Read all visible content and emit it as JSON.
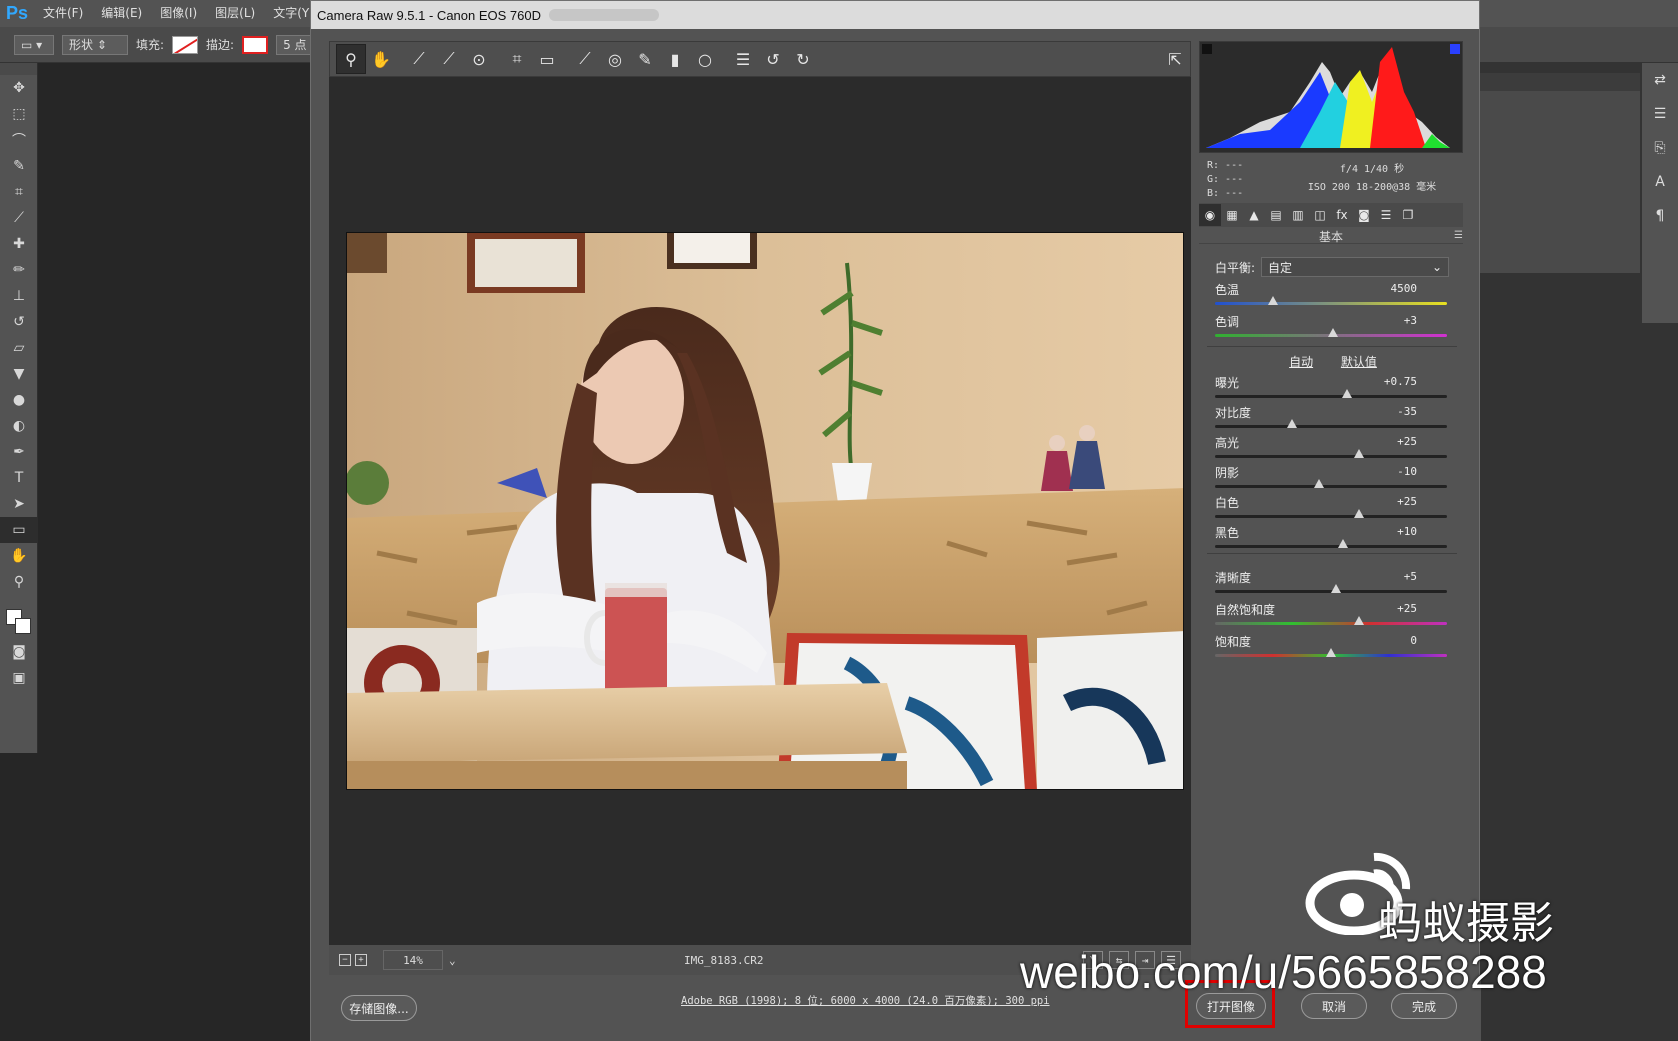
{
  "ps": {
    "logo": "Ps",
    "menu": [
      "文件(F)",
      "编辑(E)",
      "图像(I)",
      "图层(L)",
      "文字(Y)"
    ],
    "options": {
      "shape_mode": "形状",
      "fill_label": "填充:",
      "stroke_label": "描边:",
      "stroke_size": "5 点"
    },
    "tools": [
      "move-icon",
      "marquee-icon",
      "lasso-icon",
      "quick-select-icon",
      "crop-icon",
      "eyedropper-icon",
      "healing-icon",
      "brush-icon",
      "stamp-icon",
      "history-brush-icon",
      "eraser-icon",
      "bucket-icon",
      "blur-icon",
      "dodge-icon",
      "pen-icon",
      "type-icon",
      "path-select-icon",
      "rectangle-icon",
      "hand-icon",
      "zoom-icon"
    ],
    "tool_glyphs": [
      "✥",
      "⬚",
      "⌒",
      "✎",
      "⌗",
      "⟋",
      "✚",
      "✏",
      "⊥",
      "↺",
      "▱",
      "▼",
      "●",
      "◐",
      "✒",
      "T",
      "➤",
      "▭",
      "✋",
      "⚲"
    ],
    "right_icons": [
      "⇄",
      "☰",
      "⎘",
      "A",
      "¶"
    ]
  },
  "camera_raw": {
    "title": "Camera Raw 9.5.1 -  Canon EOS 760D",
    "toolbar": [
      "zoom-icon",
      "hand-icon",
      "white-balance-icon",
      "color-sampler-icon",
      "targeted-adjust-icon",
      "crop-icon",
      "straighten-icon",
      "spot-removal-icon",
      "red-eye-icon",
      "adjustment-brush-icon",
      "graduated-filter-icon",
      "radial-filter-icon",
      "preferences-icon",
      "rotate-left-icon",
      "rotate-right-icon"
    ],
    "toolbar_glyphs": [
      "⚲",
      "✋",
      "⟋",
      "⟋",
      "⊙",
      "⌗",
      "▭",
      "⟋",
      "◎",
      "✎",
      "▮",
      "○",
      "☰",
      "↺",
      "↻"
    ],
    "fullscreen_glyph": "⇱",
    "status": {
      "zoom": "14%",
      "filename": "IMG_8183.CR2",
      "view_label": "Y",
      "minus": "−",
      "plus": "+"
    },
    "workflow": "Adobe RGB (1998); 8 位; 6000 x 4000 (24.0 百万像素); 300 ppi",
    "buttons": {
      "save": "存储图像...",
      "open": "打开图像",
      "cancel": "取消",
      "done": "完成"
    },
    "histogram_info": {
      "r": "R:  ---",
      "g": "G:  ---",
      "b": "B:  ---",
      "exif1": "f/4   1/40 秒",
      "exif2": "ISO 200   18-200@38 毫米"
    },
    "panel_tabs": [
      "◉",
      "▦",
      "▲",
      "▤",
      "▥",
      "◫",
      "fx",
      "◙",
      "☰",
      "❐"
    ],
    "panel_title": "基本",
    "white_balance": {
      "label": "白平衡:",
      "value": "自定"
    },
    "auto": "自动",
    "default": "默认值",
    "sliders": [
      {
        "label": "色温",
        "value": "4500",
        "pos": 0.25,
        "track": "linear-gradient(90deg,#2050d0,#e8e020)"
      },
      {
        "label": "色调",
        "value": "+3",
        "pos": 0.51,
        "track": "linear-gradient(90deg,#30b030,#d030d0)"
      },
      {
        "label": "曝光",
        "value": "+0.75",
        "pos": 0.57,
        "track": ""
      },
      {
        "label": "对比度",
        "value": "-35",
        "pos": 0.33,
        "track": ""
      },
      {
        "label": "高光",
        "value": "+25",
        "pos": 0.62,
        "track": ""
      },
      {
        "label": "阴影",
        "value": "-10",
        "pos": 0.45,
        "track": ""
      },
      {
        "label": "白色",
        "value": "+25",
        "pos": 0.62,
        "track": ""
      },
      {
        "label": "黑色",
        "value": "+10",
        "pos": 0.55,
        "track": ""
      },
      {
        "label": "清晰度",
        "value": "+5",
        "pos": 0.52,
        "track": ""
      },
      {
        "label": "自然饱和度",
        "value": "+25",
        "pos": 0.62,
        "track": "linear-gradient(90deg,#666,#30c030,#d03030,#c030c0)"
      },
      {
        "label": "饱和度",
        "value": "0",
        "pos": 0.5,
        "track": "linear-gradient(90deg,#666,#d03030,#30c030,#3030d0,#c030c0)"
      }
    ]
  },
  "watermark": {
    "name": "蚂蚁摄影",
    "url": "weibo.com/u/5665858288"
  }
}
